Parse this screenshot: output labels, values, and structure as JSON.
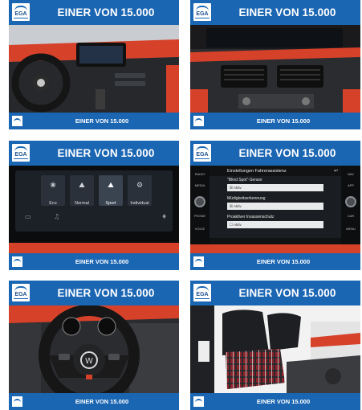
{
  "brand": {
    "logo_text": "EGA"
  },
  "cards": [
    {
      "title": "EINER VON 15.000",
      "footer": "EINER VON 15.000"
    },
    {
      "title": "EINER VON 15.000",
      "footer": "EINER VON 15.000"
    },
    {
      "title": "EINER VON 15.000",
      "footer": "EINER VON 15.000"
    },
    {
      "title": "EINER VON 15.000",
      "footer": "EINER VON 15.000"
    },
    {
      "title": "EINER VON 15.000",
      "footer": "EINER VON 15.000"
    },
    {
      "title": "EINER VON 15.000",
      "footer": "EINER VON 15.000"
    }
  ],
  "drive_modes": {
    "items": [
      "Eco",
      "Normal",
      "Sport",
      "Individual"
    ]
  },
  "assist_screen": {
    "header": "Einstellungen Fahrerassistenz",
    "left_buttons": [
      "RADIO",
      "MEDIA",
      "PHONE",
      "VOICE"
    ],
    "right_buttons": [
      "NAV",
      "APP",
      "CAR",
      "MENU"
    ],
    "options": [
      {
        "label": "\"Blind Spot\"-Sensor",
        "state": "Aktiv"
      },
      {
        "label": "Müdigkeitserkennung",
        "state": "Aktiv"
      },
      {
        "label": "Proaktiver Insassenschutz",
        "state": "Aktiv"
      }
    ]
  }
}
